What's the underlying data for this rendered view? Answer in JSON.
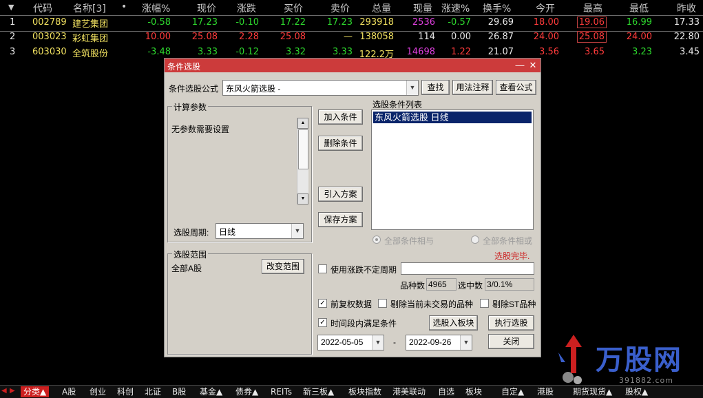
{
  "table": {
    "sort_icon": "triangle-down-icon",
    "headers": [
      "代码",
      "名称[3]",
      "•",
      "涨幅%",
      "现价",
      "涨跌",
      "买价",
      "卖价",
      "总量",
      "现量",
      "涨速%",
      "换手%",
      "今开",
      "最高",
      "最低",
      "昨收"
    ],
    "rows": [
      {
        "idx": "1",
        "code": "002789",
        "name": "建艺集团",
        "pct": "-0.58",
        "price": "17.23",
        "chg": "-0.10",
        "bid": "17.22",
        "ask": "17.23",
        "vol": "293918",
        "cur": "2536",
        "speed": "-0.57",
        "turnover": "29.69",
        "open": "18.00",
        "high": "19.06",
        "low": "16.99",
        "prev": "17.33"
      },
      {
        "idx": "2",
        "code": "003023",
        "name": "彩虹集团",
        "pct": "10.00",
        "price": "25.08",
        "chg": "2.28",
        "bid": "25.08",
        "ask": "—",
        "vol": "138058",
        "cur": "114",
        "speed": "0.00",
        "turnover": "26.87",
        "open": "24.00",
        "high": "25.08",
        "low": "24.00",
        "prev": "22.80"
      },
      {
        "idx": "3",
        "code": "603030",
        "name": "全筑股份",
        "pct": "-3.48",
        "price": "3.33",
        "chg": "-0.12",
        "bid": "3.32",
        "ask": "3.33",
        "vol": "122.2万",
        "cur": "14698",
        "speed": "1.22",
        "turnover": "21.07",
        "open": "3.56",
        "high": "3.65",
        "low": "3.23",
        "prev": "3.45"
      }
    ]
  },
  "dialog": {
    "title": "条件选股",
    "minimize_glyph": "—",
    "close_glyph": "✕",
    "formula_label": "条件选股公式",
    "formula_value": "东风火箭选股 -",
    "find_btn": "查找",
    "usage_btn": "用法注释",
    "view_btn": "查看公式",
    "params_group": "计算参数",
    "params_text": "无参数需要设置",
    "period_label": "选股周期:",
    "period_value": "日线",
    "range_group": "选股范围",
    "range_value": "全部A股",
    "change_range_btn": "改变范围",
    "add_btn": "加入条件",
    "delete_btn": "删除条件",
    "import_btn": "引入方案",
    "save_btn": "保存方案",
    "list_label": "选股条件列表",
    "list_items": [
      "东风火箭选股  日线"
    ],
    "radio_and": "全部条件相与",
    "radio_or": "全部条件相或",
    "status": "选股完毕.",
    "use_period_label": "使用涨跌不定周期",
    "count_label": "品种数",
    "count_value": "4965",
    "selected_label": "选中数",
    "selected_value": "3/0.1%",
    "prefq_label": "前复权数据",
    "prefq_checked": "✓",
    "exclude_notrade_label": "剔除当前未交易的品种",
    "exclude_st_label": "剔除ST品种",
    "interval_label": "时间段内满足条件",
    "interval_checked": "✓",
    "to_block_btn": "选股入板块",
    "run_btn": "执行选股",
    "date_from": "2022-05-05",
    "date_sep": "-",
    "date_to": "2022-09-26",
    "close_btn": "关闭"
  },
  "tabs": {
    "left_arrow": "◀",
    "right_arrow": "▶",
    "items": [
      "分类▲",
      "A股",
      "创业",
      "科创",
      "北证",
      "B股",
      "基金▲",
      "债券▲",
      "REITs",
      "新三板▲",
      "板块指数",
      "港美联动",
      "自选",
      "板块",
      "自定▲",
      "港股",
      "期货现货▲",
      "股权▲"
    ]
  },
  "logo": {
    "text": "万股网",
    "sub": "391882.com"
  },
  "colors": {
    "up": "#ff3b3b",
    "down": "#2ed92e",
    "title_bar": "#cc3b3b",
    "selection": "#0a246a",
    "active_tab": "#cc2020"
  }
}
